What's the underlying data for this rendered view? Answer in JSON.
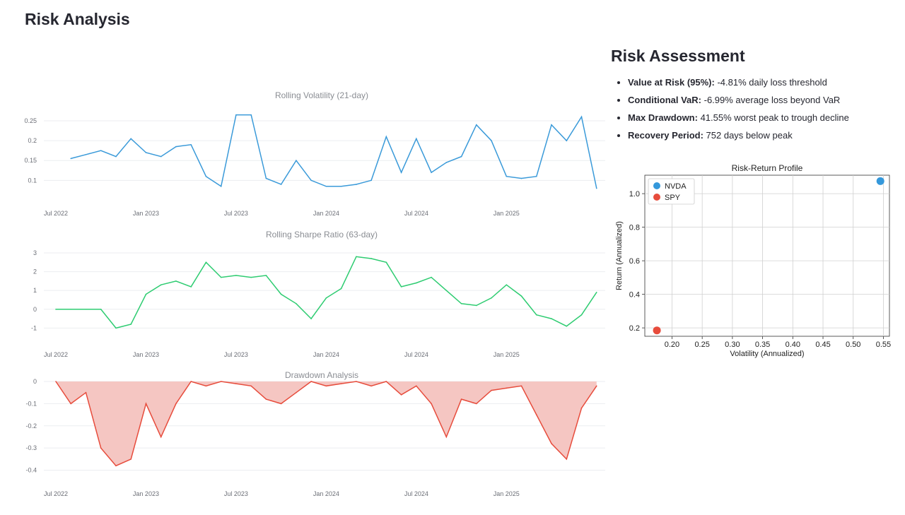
{
  "page": {
    "title": "Risk Analysis"
  },
  "assessment": {
    "title": "Risk Assessment",
    "items": [
      {
        "label": "Value at Risk (95%):",
        "text": " -4.81% daily loss threshold"
      },
      {
        "label": "Conditional VaR:",
        "text": " -6.99% average loss beyond VaR"
      },
      {
        "label": "Max Drawdown:",
        "text": " 41.55% worst peak to trough decline"
      },
      {
        "label": "Recovery Period:",
        "text": " 752 days below peak"
      }
    ]
  },
  "colors": {
    "volatility": "#3a9ad9",
    "sharpe": "#2ecc71",
    "drawdown": "#e74c3c",
    "drawdown_fill": "#f5c6c2",
    "nvda": "#3498db",
    "spy": "#e74c3c"
  },
  "chart_data": [
    {
      "type": "line",
      "title": "Rolling Volatility (21-day)",
      "xlabel": "",
      "ylabel": "",
      "x_ticks": [
        "Jul 2022",
        "Jan 2023",
        "Jul 2023",
        "Jan 2024",
        "Jul 2024",
        "Jan 2025"
      ],
      "y_ticks": [
        0.1,
        0.15,
        0.2,
        0.25
      ],
      "ylim": [
        0.065,
        0.275
      ],
      "x": [
        "2022-08",
        "2022-09",
        "2022-10",
        "2022-11",
        "2022-12",
        "2023-01",
        "2023-02",
        "2023-03",
        "2023-04",
        "2023-05",
        "2023-06",
        "2023-07",
        "2023-08",
        "2023-09",
        "2023-10",
        "2023-11",
        "2023-12",
        "2024-01",
        "2024-02",
        "2024-03",
        "2024-04",
        "2024-05",
        "2024-06",
        "2024-07",
        "2024-08",
        "2024-09",
        "2024-10",
        "2024-11",
        "2024-12",
        "2025-01",
        "2025-02",
        "2025-03",
        "2025-04",
        "2025-05",
        "2025-06",
        "2025-07"
      ],
      "values": [
        0.155,
        0.165,
        0.175,
        0.16,
        0.205,
        0.17,
        0.16,
        0.185,
        0.19,
        0.11,
        0.085,
        0.265,
        0.265,
        0.105,
        0.09,
        0.15,
        0.1,
        0.085,
        0.085,
        0.09,
        0.1,
        0.21,
        0.12,
        0.205,
        0.12,
        0.145,
        0.16,
        0.24,
        0.2,
        0.11,
        0.105,
        0.11,
        0.24,
        0.2,
        0.26,
        0.08
      ],
      "grid": true
    },
    {
      "type": "line",
      "title": "Rolling Sharpe Ratio (63-day)",
      "xlabel": "",
      "ylabel": "",
      "x_ticks": [
        "Jul 2022",
        "Jan 2023",
        "Jul 2023",
        "Jan 2024",
        "Jul 2024",
        "Jan 2025"
      ],
      "y_ticks": [
        -1,
        0,
        1,
        2,
        3
      ],
      "ylim": [
        -1.4,
        3.3
      ],
      "x": [
        "2022-07",
        "2022-08",
        "2022-09",
        "2022-10",
        "2022-11",
        "2022-12",
        "2023-01",
        "2023-02",
        "2023-03",
        "2023-04",
        "2023-05",
        "2023-06",
        "2023-07",
        "2023-08",
        "2023-09",
        "2023-10",
        "2023-11",
        "2023-12",
        "2024-01",
        "2024-02",
        "2024-03",
        "2024-04",
        "2024-05",
        "2024-06",
        "2024-07",
        "2024-08",
        "2024-09",
        "2024-10",
        "2024-11",
        "2024-12",
        "2025-01",
        "2025-02",
        "2025-03",
        "2025-04",
        "2025-05",
        "2025-06",
        "2025-07"
      ],
      "values": [
        0,
        0,
        0,
        0,
        -1.0,
        -0.8,
        0.8,
        1.3,
        1.5,
        1.2,
        2.5,
        1.7,
        1.8,
        1.7,
        1.8,
        0.8,
        0.3,
        -0.5,
        0.6,
        1.1,
        2.8,
        2.7,
        2.5,
        1.2,
        1.4,
        1.7,
        1.0,
        0.3,
        0.2,
        0.6,
        1.3,
        0.7,
        -0.3,
        -0.5,
        -0.9,
        -0.3,
        0.9
      ],
      "grid": true
    },
    {
      "type": "area",
      "title": "Drawdown Analysis",
      "xlabel": "",
      "ylabel": "",
      "x_ticks": [
        "Jul 2022",
        "Jan 2023",
        "Jul 2023",
        "Jan 2024",
        "Jul 2024",
        "Jan 2025"
      ],
      "y_ticks": [
        0,
        -0.1,
        -0.2,
        -0.3,
        -0.4
      ],
      "ylim": [
        -0.43,
        0.0
      ],
      "x": [
        "2022-07",
        "2022-08",
        "2022-09",
        "2022-10",
        "2022-11",
        "2022-12",
        "2023-01",
        "2023-02",
        "2023-03",
        "2023-04",
        "2023-05",
        "2023-06",
        "2023-07",
        "2023-08",
        "2023-09",
        "2023-10",
        "2023-11",
        "2023-12",
        "2024-01",
        "2024-02",
        "2024-03",
        "2024-04",
        "2024-05",
        "2024-06",
        "2024-07",
        "2024-08",
        "2024-09",
        "2024-10",
        "2024-11",
        "2024-12",
        "2025-01",
        "2025-02",
        "2025-03",
        "2025-04",
        "2025-05",
        "2025-06",
        "2025-07"
      ],
      "values": [
        0,
        -0.1,
        -0.05,
        -0.3,
        -0.38,
        -0.35,
        -0.1,
        -0.25,
        -0.1,
        0,
        -0.02,
        0,
        -0.01,
        -0.02,
        -0.08,
        -0.1,
        -0.05,
        0,
        -0.02,
        -0.01,
        0,
        -0.02,
        0,
        -0.06,
        -0.02,
        -0.1,
        -0.25,
        -0.08,
        -0.1,
        -0.04,
        -0.03,
        -0.02,
        -0.15,
        -0.28,
        -0.35,
        -0.12,
        -0.02
      ],
      "grid": true
    },
    {
      "type": "scatter",
      "title": "Risk-Return Profile",
      "xlabel": "Volatility (Annualized)",
      "ylabel": "Return (Annualized)",
      "x_ticks": [
        0.2,
        0.25,
        0.3,
        0.35,
        0.4,
        0.45,
        0.5,
        0.55
      ],
      "y_ticks": [
        0.2,
        0.4,
        0.6,
        0.8,
        1.0
      ],
      "xlim": [
        0.155,
        0.56
      ],
      "ylim": [
        0.15,
        1.11
      ],
      "series": [
        {
          "name": "NVDA",
          "x": [
            0.545
          ],
          "y": [
            1.075
          ]
        },
        {
          "name": "SPY",
          "x": [
            0.175
          ],
          "y": [
            0.185
          ]
        }
      ],
      "legend": "top-left",
      "grid": true
    }
  ]
}
